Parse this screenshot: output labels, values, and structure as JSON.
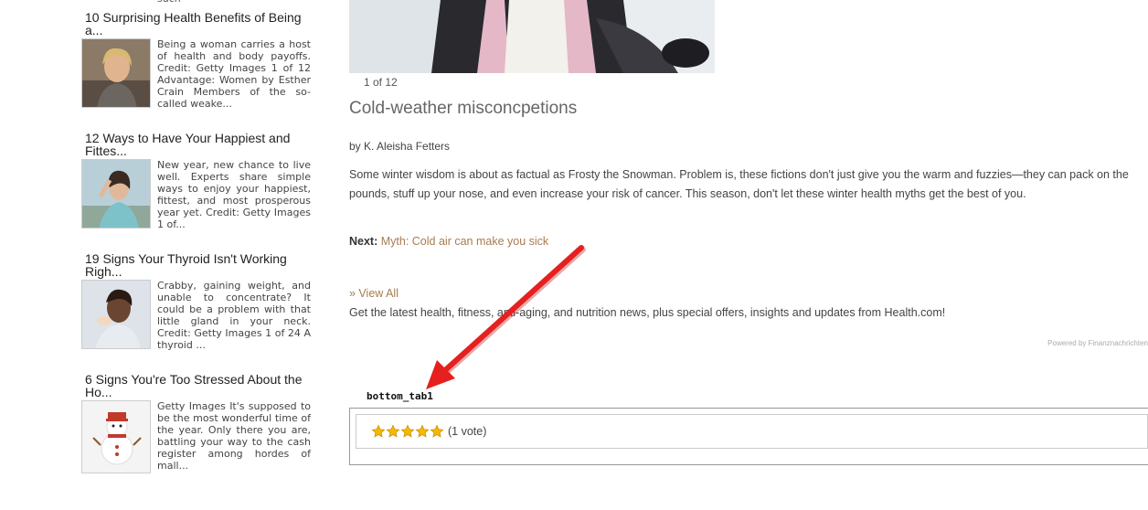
{
  "sidebar": {
    "top_cut_text": "such",
    "articles": [
      {
        "title": "10 Surprising Health Benefits of Being a...",
        "snippet": "Being a woman carries a host of health and body payoffs. Credit: Getty Images 1 of 12 Advantage: Women by Esther Crain Members of the so-called weake..."
      },
      {
        "title": "12 Ways to Have Your Happiest and Fittes...",
        "snippet": "New year, new chance to live well. Experts share simple ways to enjoy your happiest, fittest, and most prosperous year yet. Credit: Getty Images 1 of..."
      },
      {
        "title": "19 Signs Your Thyroid Isn't Working Righ...",
        "snippet": "Crabby, gaining weight, and unable to concentrate? It could be a problem with that little gland in your neck. Credit: Getty Images 1 of 24 A thyroid ..."
      },
      {
        "title": "6 Signs You're Too Stressed About the Ho...",
        "snippet": "Getty Images It's supposed to be the most wonderful time of the year. Only there you are, battling your way to the cash register among hordes of mall..."
      }
    ]
  },
  "main": {
    "counter": "1 of 12",
    "headline": "Cold-weather misconcpetions",
    "byline": "by K. Aleisha Fetters",
    "description": "Some winter wisdom is about as factual as Frosty the Snowman. Problem is, these fictions don't just give you the warm and fuzzies—they can pack on the pounds, stuff up your nose, and even increase your risk of cancer. This season, don't let these winter health myths get the best of you.",
    "next_label": "Next:",
    "next_link": "Myth: Cold air can make you sick",
    "view_all": "» View All",
    "promo": "Get the latest health, fitness, anti-aging, and nutrition news, plus special offers, insights and updates from Health.com!",
    "powered_by": "Powered by Finanznachrichten"
  },
  "tab": {
    "label": "bottom_tab1",
    "rating": 5,
    "vote_text": "(1 vote)"
  },
  "colors": {
    "link": "#a67c4e",
    "arrow": "#e5201f",
    "star": "#f5b800"
  }
}
